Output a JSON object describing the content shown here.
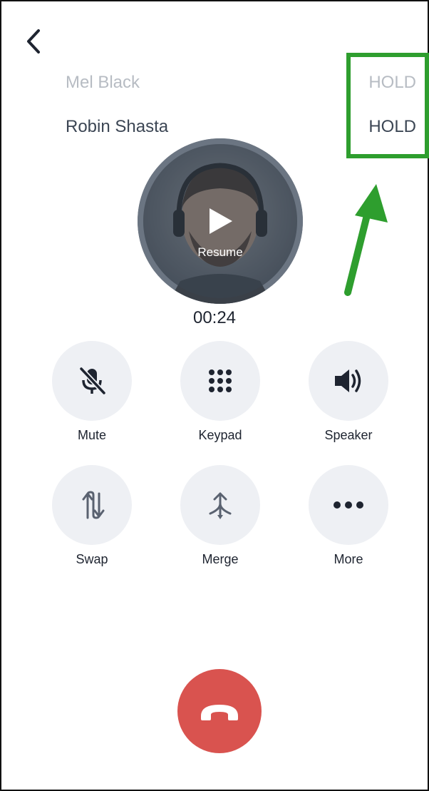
{
  "header": {
    "back_icon": "chevron-left-icon"
  },
  "calls": [
    {
      "name": "Mel Black",
      "status": "HOLD"
    },
    {
      "name": "Robin Shasta",
      "status": "HOLD"
    }
  ],
  "avatar": {
    "overlay_label": "Resume",
    "overlay_icon": "play-icon"
  },
  "timer": "00:24",
  "controls": {
    "mute": {
      "label": "Mute",
      "icon": "mic-off-icon"
    },
    "keypad": {
      "label": "Keypad",
      "icon": "keypad-icon"
    },
    "speaker": {
      "label": "Speaker",
      "icon": "speaker-icon"
    },
    "swap": {
      "label": "Swap",
      "icon": "swap-icon"
    },
    "merge": {
      "label": "Merge",
      "icon": "merge-icon"
    },
    "more": {
      "label": "More",
      "icon": "more-icon"
    }
  },
  "end_call": {
    "icon": "hang-up-icon"
  },
  "annotation": {
    "color": "#2e9e2e"
  },
  "colors": {
    "end_call": "#d9534f",
    "control_bg": "#eef0f4",
    "text_dim": "#b7bcc3",
    "text": "#3c4654"
  }
}
